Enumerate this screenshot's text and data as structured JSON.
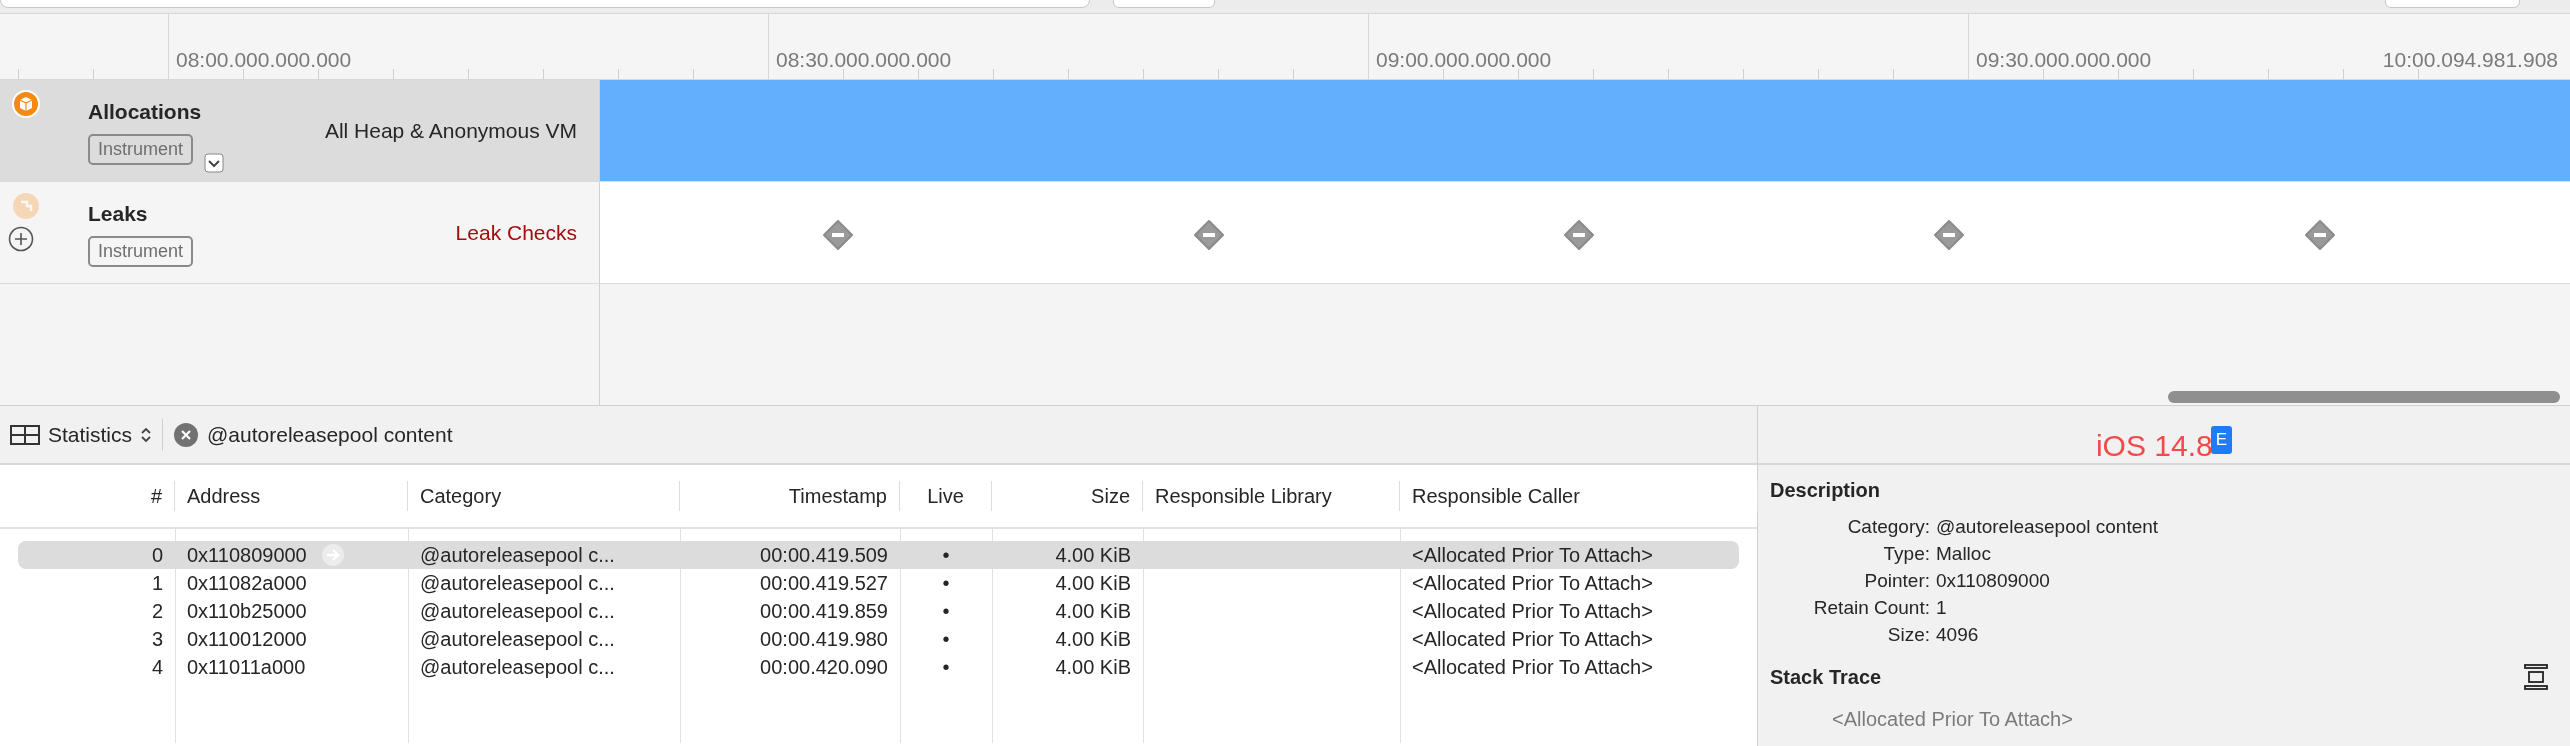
{
  "ruler": {
    "labels": [
      "08:00.000.000.000",
      "08:30.000.000.000",
      "09:00.000.000.000",
      "09:30.000.000.000",
      "10:00.094.981.908"
    ]
  },
  "tracks": [
    {
      "name": "Allocations",
      "tag": "Instrument",
      "detail": "All Heap & Anonymous VM",
      "kind": "allocations",
      "selected": true,
      "muted_icon": false,
      "has_menu": true
    },
    {
      "name": "Leaks",
      "tag": "Instrument",
      "detail": "Leak Checks",
      "kind": "leaks",
      "selected": false,
      "muted_icon": true,
      "has_menu": false
    }
  ],
  "toolbar": {
    "view": "Statistics",
    "filter": "@autoreleasepool content"
  },
  "table": {
    "columns": [
      "#",
      "Address",
      "Category",
      "Timestamp",
      "Live",
      "Size",
      "Responsible Library",
      "Responsible Caller"
    ],
    "rows": [
      {
        "cells": [
          "0",
          "0x110809000",
          "@autoreleasepool c...",
          "00:00.419.509",
          "•",
          "4.00 KiB",
          "",
          "<Allocated Prior To Attach>"
        ],
        "selected": true
      },
      {
        "cells": [
          "1",
          "0x11082a000",
          "@autoreleasepool c...",
          "00:00.419.527",
          "•",
          "4.00 KiB",
          "",
          "<Allocated Prior To Attach>"
        ],
        "selected": false
      },
      {
        "cells": [
          "2",
          "0x110b25000",
          "@autoreleasepool c...",
          "00:00.419.859",
          "•",
          "4.00 KiB",
          "",
          "<Allocated Prior To Attach>"
        ],
        "selected": false
      },
      {
        "cells": [
          "3",
          "0x110012000",
          "@autoreleasepool c...",
          "00:00.419.980",
          "•",
          "4.00 KiB",
          "",
          "<Allocated Prior To Attach>"
        ],
        "selected": false
      },
      {
        "cells": [
          "4",
          "0x11011a000",
          "@autoreleasepool c...",
          "00:00.420.090",
          "•",
          "4.00 KiB",
          "",
          "<Allocated Prior To Attach>"
        ],
        "selected": false
      }
    ]
  },
  "annotation": {
    "text": "iOS 14.8",
    "badge": "E"
  },
  "inspector": {
    "description_title": "Description",
    "fields": [
      {
        "label": "Category:",
        "value": "@autoreleasepool content"
      },
      {
        "label": "Type:",
        "value": "Malloc"
      },
      {
        "label": "Pointer:",
        "value": "0x110809000"
      },
      {
        "label": "Retain Count:",
        "value": "1"
      },
      {
        "label": "Size:",
        "value": "4096"
      }
    ],
    "stack_title": "Stack Trace",
    "stack_frames": [
      "<Allocated Prior To Attach>"
    ]
  }
}
